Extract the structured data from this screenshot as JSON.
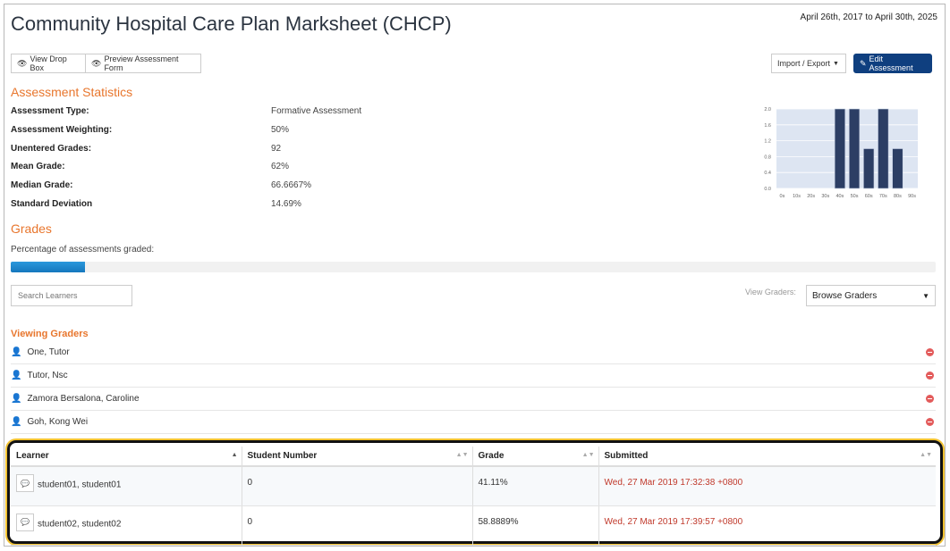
{
  "header": {
    "title": "Community Hospital Care Plan Marksheet (CHCP)",
    "date_range": "April 26th, 2017 to April 30th, 2025"
  },
  "toolbar": {
    "view_drop_box": "View Drop Box",
    "preview_form": "Preview Assessment Form",
    "import_export": "Import / Export",
    "edit_assessment": "Edit Assessment"
  },
  "stats": {
    "heading": "Assessment Statistics",
    "rows": [
      {
        "label": "Assessment Type:",
        "value": "Formative Assessment"
      },
      {
        "label": "Assessment Weighting:",
        "value": "50%"
      },
      {
        "label": "Unentered Grades:",
        "value": "92"
      },
      {
        "label": "Mean Grade:",
        "value": "62%"
      },
      {
        "label": "Median Grade:",
        "value": "66.6667%"
      },
      {
        "label": "Standard Deviation",
        "value": "14.69%"
      }
    ]
  },
  "chart_data": {
    "type": "bar",
    "categories": [
      "0s",
      "10s",
      "20s",
      "30s",
      "40s",
      "50s",
      "60s",
      "70s",
      "80s",
      "90s"
    ],
    "values": [
      0,
      0,
      0,
      0,
      2,
      2,
      1,
      2,
      1,
      0
    ],
    "ylim": [
      0,
      2.0
    ],
    "yticks": [
      "2.0",
      "1.6",
      "1.2",
      "0.8",
      "0.4",
      "0.0"
    ],
    "colors": {
      "bar": "#2c3e64",
      "background": "#dde5f2"
    }
  },
  "grades": {
    "heading": "Grades",
    "percentage_label": "Percentage of assessments graded:",
    "progress_fraction": 0.08
  },
  "filters": {
    "search_placeholder": "Search Learners",
    "view_graders_label": "View Graders:",
    "browse_graders": "Browse Graders"
  },
  "graders": {
    "heading": "Viewing Graders",
    "items": [
      "One, Tutor",
      "Tutor, Nsc",
      "Zamora Bersalona, Caroline",
      "Goh, Kong Wei"
    ]
  },
  "table": {
    "headers": [
      "Learner",
      "Student Number",
      "Grade",
      "Submitted"
    ],
    "rows": [
      {
        "learner": "student01, student01",
        "number": "0",
        "grade": "41.11%",
        "submitted": "Wed, 27 Mar 2019 17:32:38 +0800"
      },
      {
        "learner": "student02, student02",
        "number": "0",
        "grade": "58.8889%",
        "submitted": "Wed, 27 Mar 2019 17:39:57 +0800"
      }
    ]
  }
}
